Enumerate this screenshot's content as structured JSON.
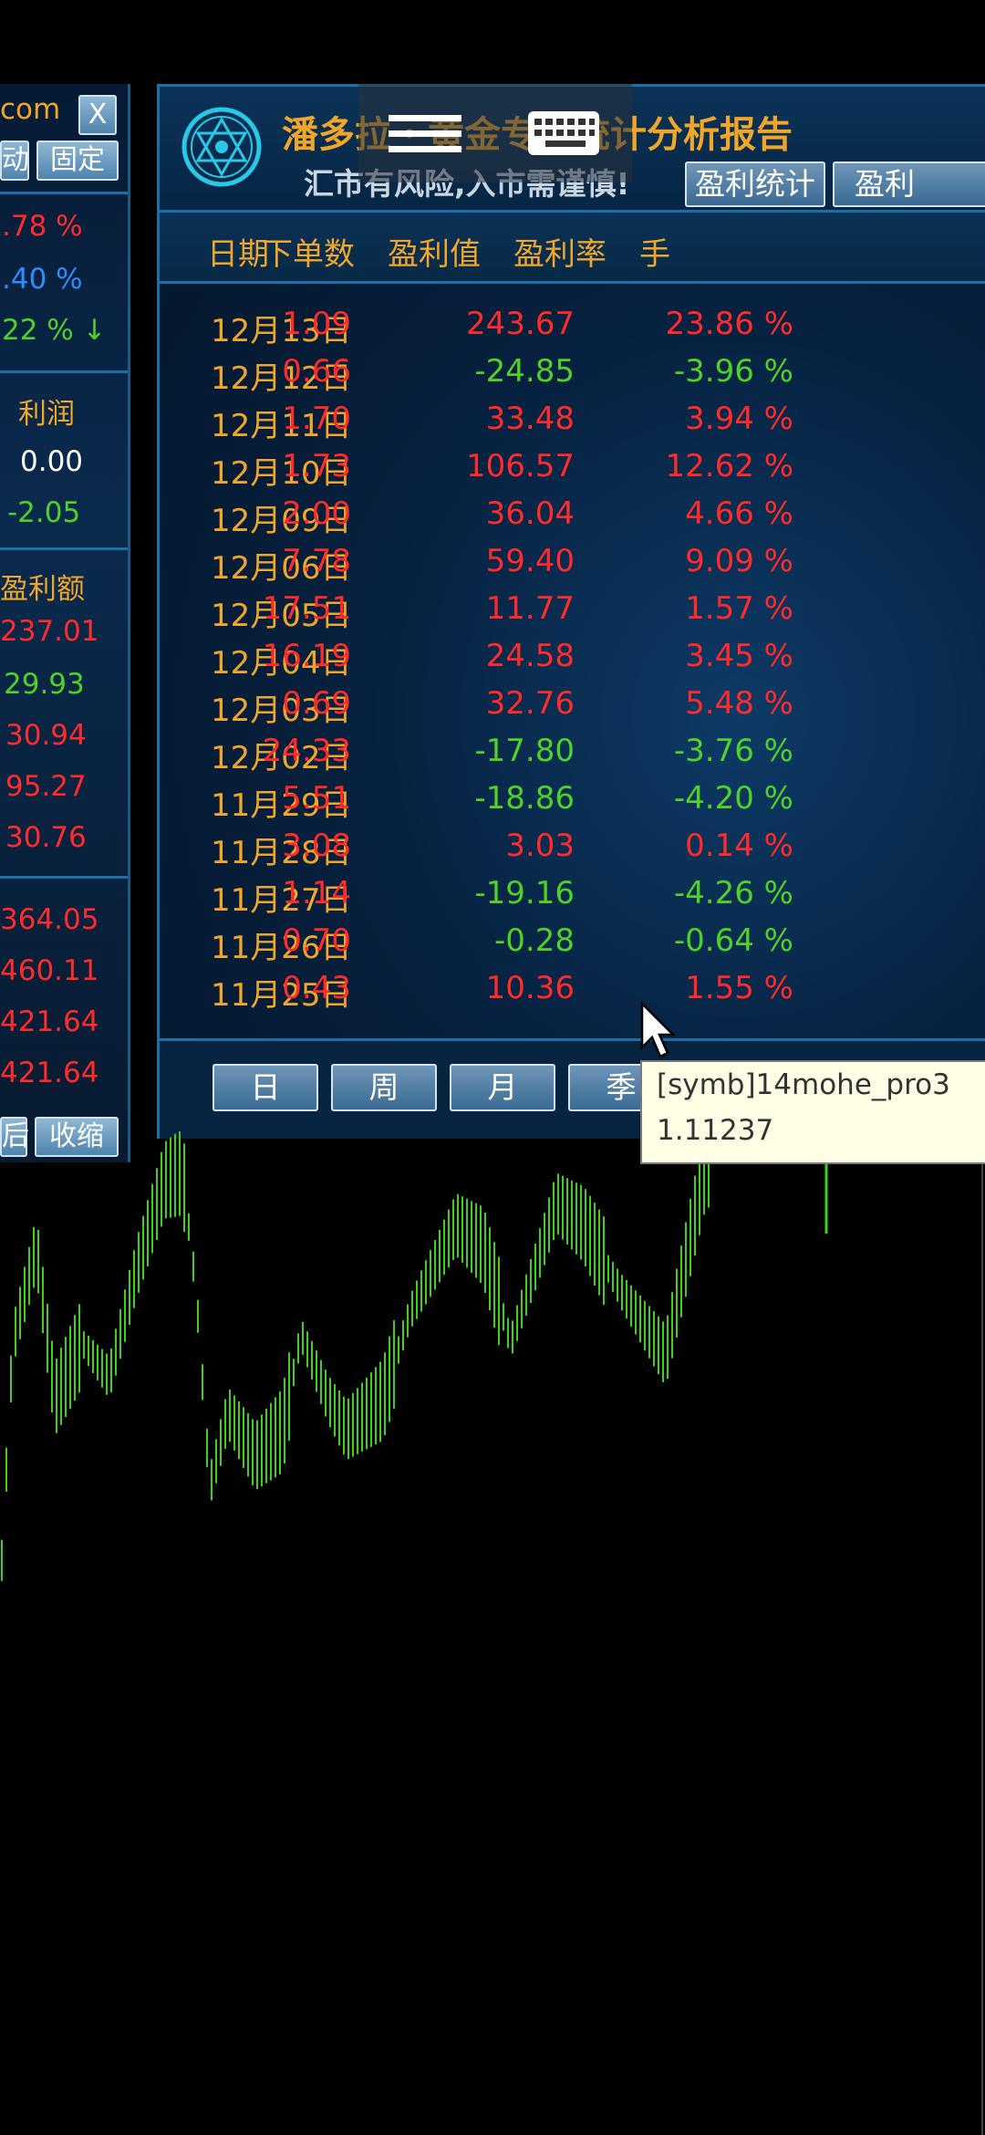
{
  "left_panel": {
    "top_text": "com",
    "close_label": "X",
    "top_buttons": [
      "动",
      "固定"
    ],
    "percents": [
      {
        "text": ".78 %",
        "color": "#ff2a2a"
      },
      {
        "text": ".40 %",
        "color": "#2f8cff"
      },
      {
        "text": "22 % ↓",
        "color": "#4fd12a"
      }
    ],
    "profit_header": "利润",
    "profit_values": [
      {
        "text": "0.00",
        "color": "#ffffff"
      },
      {
        "text": "-2.05",
        "color": "#4fd12a"
      }
    ],
    "amount_header": "盈利额",
    "amounts": [
      {
        "text": "237.01",
        "color": "#ff2a2a"
      },
      {
        "text": "29.93",
        "color": "#4fd12a"
      },
      {
        "text": "30.94",
        "color": "#ff2a2a"
      },
      {
        "text": "95.27",
        "color": "#ff2a2a"
      },
      {
        "text": "30.76",
        "color": "#ff2a2a"
      }
    ],
    "totals": [
      {
        "text": "364.05",
        "color": "#ff2a2a"
      },
      {
        "text": "460.11",
        "color": "#ff2a2a"
      },
      {
        "text": "421.64",
        "color": "#ff2a2a"
      },
      {
        "text": "421.64",
        "color": "#ff2a2a"
      }
    ],
    "bottom_buttons": [
      "后",
      "收缩"
    ]
  },
  "header": {
    "title": "潘多拉・黄金专业统计分析报告",
    "subtitle": "汇市有风险,入市需谨慎!",
    "buttons": [
      "盈利统计",
      "盈利"
    ]
  },
  "columns": [
    "日期",
    "下单数",
    "盈利值",
    "盈利率",
    "手"
  ],
  "rows": [
    {
      "date": "12月13日",
      "orders": "1.09",
      "profit": "243.67",
      "rate": "23.86 %",
      "color": "#ff2a2a"
    },
    {
      "date": "12月12日",
      "orders": "0.66",
      "profit": "-24.85",
      "rate": "-3.96 %",
      "color": "#4fd12a"
    },
    {
      "date": "12月11日",
      "orders": "1.70",
      "profit": "33.48",
      "rate": "3.94 %",
      "color": "#ff2a2a"
    },
    {
      "date": "12月10日",
      "orders": "1.73",
      "profit": "106.57",
      "rate": "12.62 %",
      "color": "#ff2a2a"
    },
    {
      "date": "12月09日",
      "orders": "2.00",
      "profit": "36.04",
      "rate": "4.66 %",
      "color": "#ff2a2a"
    },
    {
      "date": "12月06日",
      "orders": "7.78",
      "profit": "59.40",
      "rate": "9.09 %",
      "color": "#ff2a2a"
    },
    {
      "date": "12月05日",
      "orders": "17.51",
      "profit": "11.77",
      "rate": "1.57 %",
      "color": "#ff2a2a"
    },
    {
      "date": "12月04日",
      "orders": "16.19",
      "profit": "24.58",
      "rate": "3.45 %",
      "color": "#ff2a2a"
    },
    {
      "date": "12月03日",
      "orders": "0.69",
      "profit": "32.76",
      "rate": "5.48 %",
      "color": "#ff2a2a"
    },
    {
      "date": "12月02日",
      "orders": "24.33",
      "profit": "-17.80",
      "rate": "-3.76 %",
      "color": "#4fd12a"
    },
    {
      "date": "11月29日",
      "orders": "5.51",
      "profit": "-18.86",
      "rate": "-4.20 %",
      "color": "#4fd12a"
    },
    {
      "date": "11月28日",
      "orders": "3.08",
      "profit": "3.03",
      "rate": "0.14 %",
      "color": "#ff2a2a"
    },
    {
      "date": "11月27日",
      "orders": "1.14",
      "profit": "-19.16",
      "rate": "-4.26 %",
      "color": "#4fd12a"
    },
    {
      "date": "11月26日",
      "orders": "0.70",
      "profit": "-0.28",
      "rate": "-0.64 %",
      "color": "#4fd12a"
    },
    {
      "date": "11月25日",
      "orders": "0.43",
      "profit": "10.36",
      "rate": "1.55 %",
      "color": "#ff2a2a"
    }
  ],
  "order_color": "#ff2a2a",
  "period_buttons": [
    "日",
    "周",
    "月",
    "季"
  ],
  "tooltip": {
    "line1": "[symb]14mohe_pro3",
    "line2": "1.11237"
  },
  "colors": {
    "accent": "#f0a629",
    "border": "#1e6fa6",
    "positive": "#ff2a2a",
    "negative": "#4fd12a",
    "chart": "#3fd11a"
  }
}
